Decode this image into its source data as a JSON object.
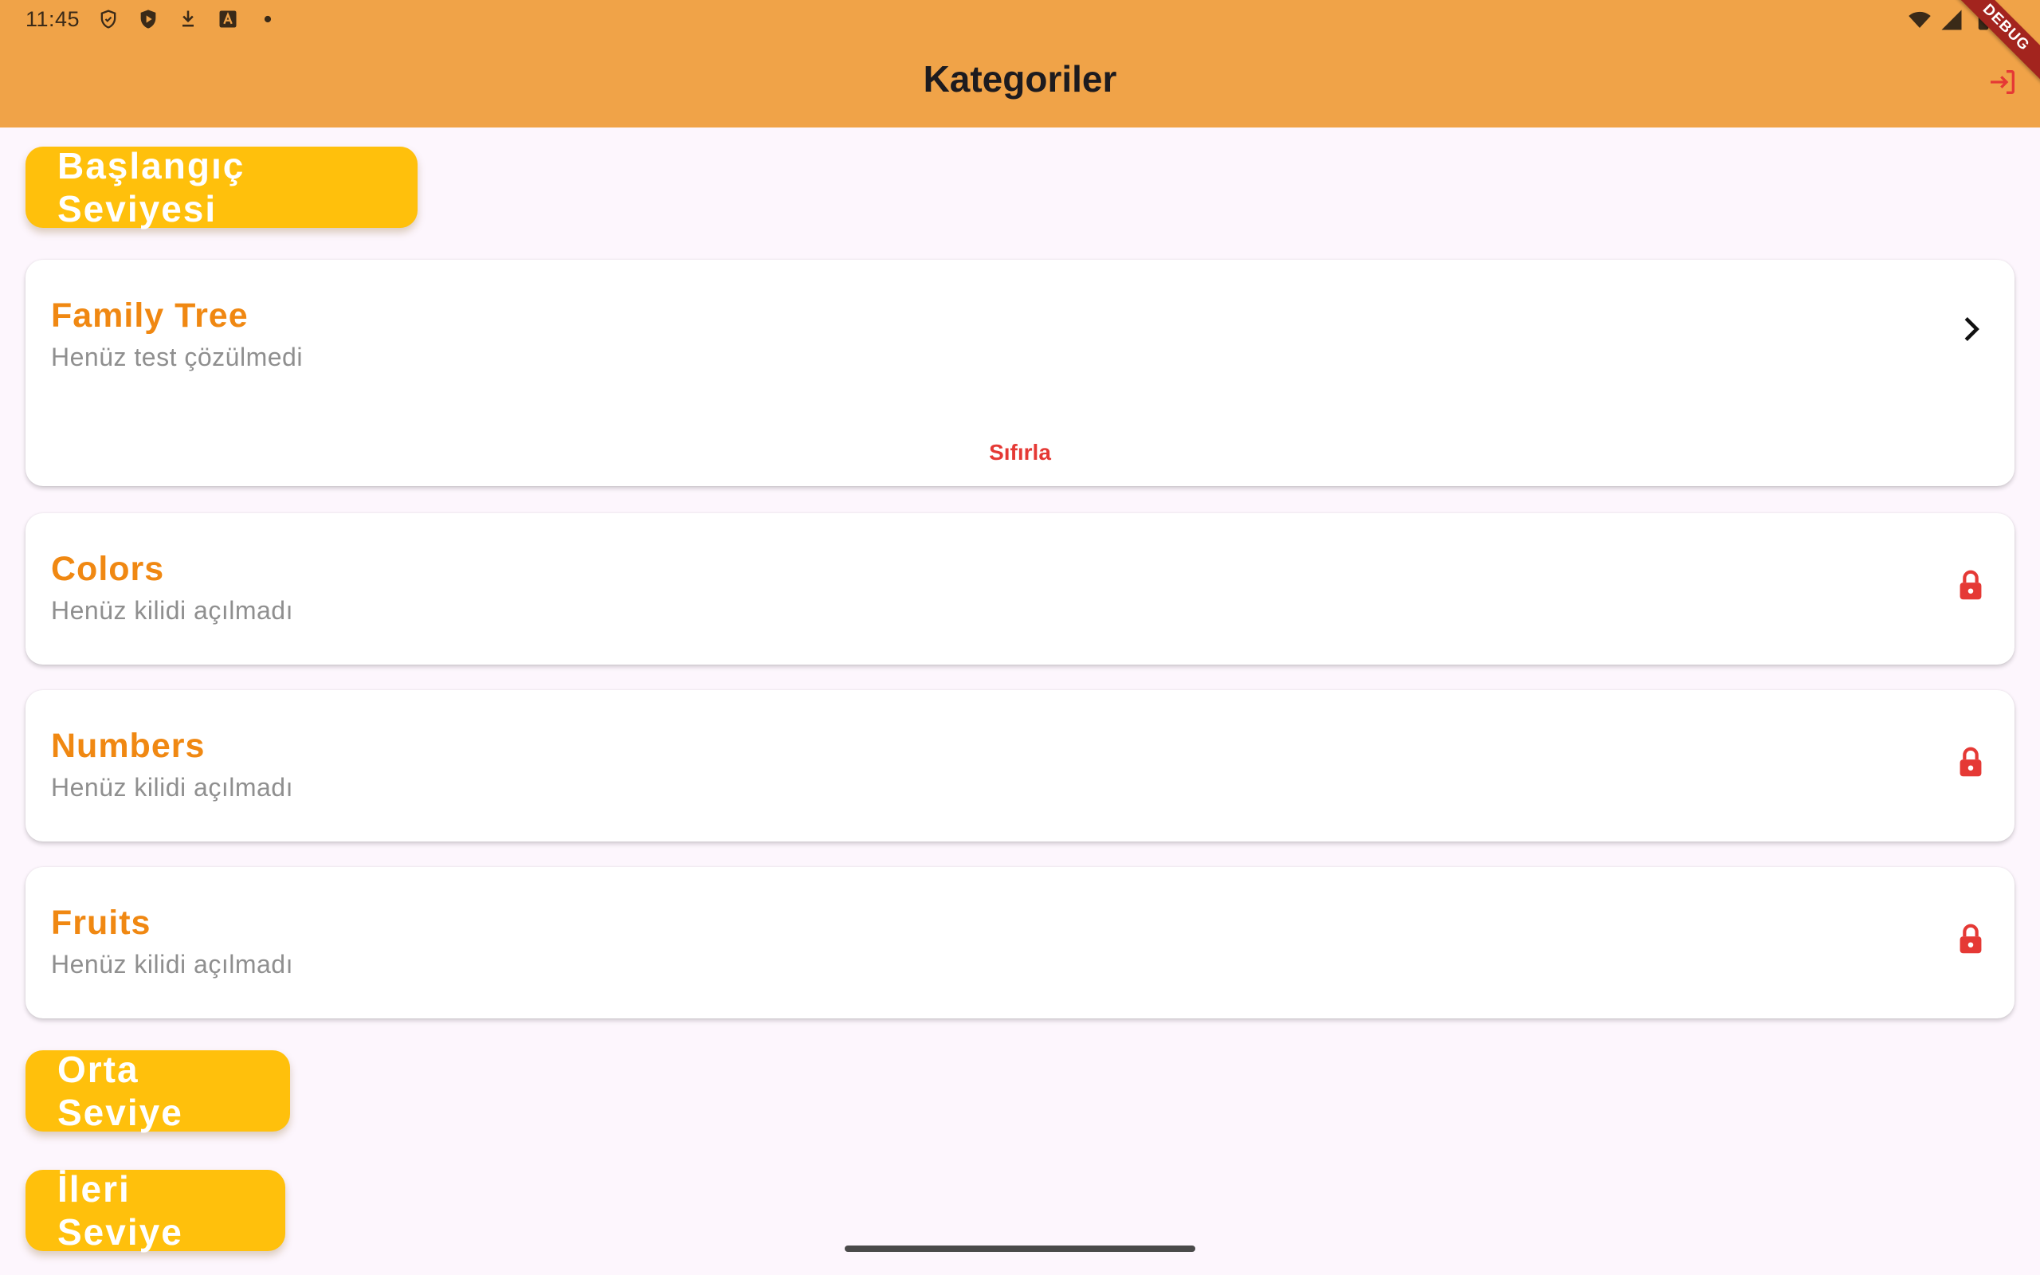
{
  "status_bar": {
    "time": "11:45",
    "icons": [
      "shield-icon",
      "play-protect-icon",
      "download-icon",
      "a-icon",
      "dot-icon"
    ],
    "right_icons": [
      "wifi-icon",
      "signal-icon",
      "battery-icon"
    ]
  },
  "app_bar": {
    "title": "Kategoriler",
    "action_icon": "logout-icon",
    "background": "#f0a348",
    "debug_label": "DEBUG"
  },
  "levels": [
    {
      "label": "Başlangıç Seviyesi",
      "categories": [
        {
          "title": "Family Tree",
          "subtitle": "Henüz test çözülmedi",
          "trailing_icon": "chevron-right-icon",
          "action": "Sıfırla"
        },
        {
          "title": "Colors",
          "subtitle": "Henüz kilidi açılmadı",
          "trailing_icon": "lock-icon"
        },
        {
          "title": "Numbers",
          "subtitle": "Henüz kilidi açılmadı",
          "trailing_icon": "lock-icon"
        },
        {
          "title": "Fruits",
          "subtitle": "Henüz kilidi açılmadı",
          "trailing_icon": "lock-icon"
        }
      ]
    },
    {
      "label": "Orta Seviye"
    },
    {
      "label": "İleri Seviye"
    }
  ],
  "colors": {
    "accent": "#ffc00c",
    "title": "#f08812",
    "danger": "#e53935",
    "background": "#fdf6fd"
  }
}
